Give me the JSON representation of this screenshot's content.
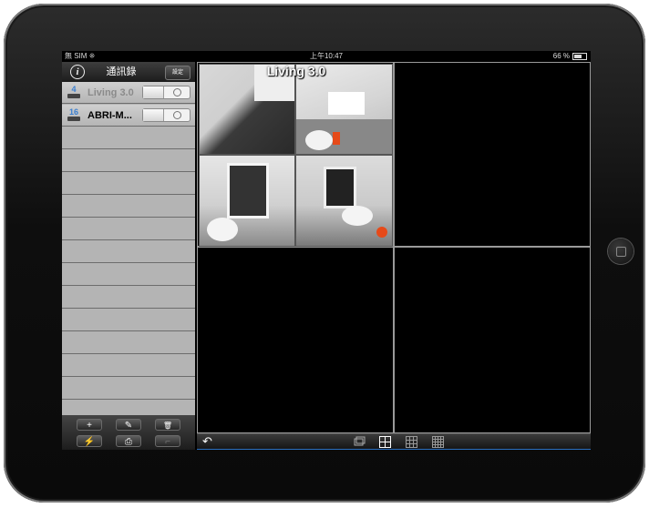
{
  "statusbar": {
    "carrier": "無 SIM ⁜",
    "time": "上午10:47",
    "battery": "66 %"
  },
  "sidebar": {
    "title": "通訊錄",
    "settings_label": "設定",
    "devices": [
      {
        "icon_number": "4",
        "name": "Living 3.0",
        "active": false
      },
      {
        "icon_number": "16",
        "name": "ABRI-M...",
        "active": true
      }
    ],
    "tools": {
      "add": "+",
      "edit": "✎",
      "delete": "🗑"
    },
    "tools2": {
      "connect": "⚡",
      "print": "⎙",
      "chart": "⌐"
    }
  },
  "main": {
    "cell_label": "Living 3.0"
  },
  "bottombar": {
    "back": "↶"
  },
  "colors": {
    "accent": "#2a6fc0",
    "sidebar_bg": "#b4b4b4",
    "screen_bg": "#000000"
  },
  "icons": [
    "info-icon",
    "device-icon",
    "toggle-off",
    "add-icon",
    "edit-icon",
    "trash-icon",
    "plug-icon",
    "printer-icon",
    "chart-icon",
    "back-icon",
    "swap-icon",
    "layout-1x1-icon",
    "layout-2x2-icon",
    "layout-3x3-icon",
    "layout-4x4-icon"
  ]
}
